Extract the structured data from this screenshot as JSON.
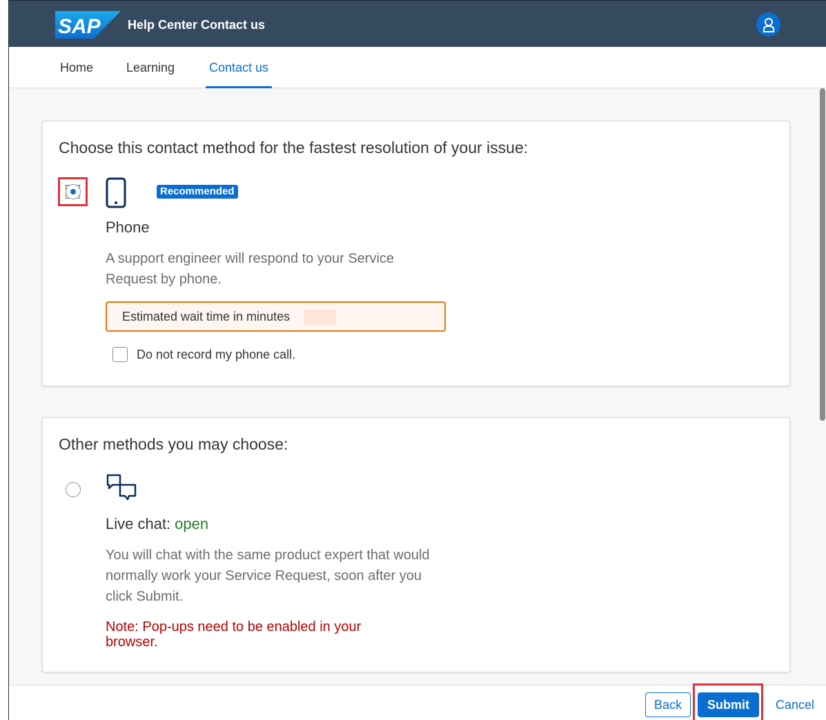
{
  "shell": {
    "logo_text": "SAP",
    "title": "Help Center Contact us"
  },
  "tabs": [
    {
      "label": "Home",
      "active": false
    },
    {
      "label": "Learning",
      "active": false
    },
    {
      "label": "Contact us",
      "active": true
    }
  ],
  "recommended_card": {
    "heading": "Choose this contact method for the fastest resolution of your issue:",
    "option": {
      "badge": "Recommended",
      "icon": "phone-icon",
      "title": "Phone",
      "description": "A support engineer will respond to your Service Request by phone.",
      "wait_label": "Estimated wait time in minutes",
      "selected": true
    },
    "checkbox_label": "Do not record my phone call."
  },
  "other_card": {
    "heading": "Other methods you may choose:",
    "option": {
      "icon": "chat-bubbles-icon",
      "title": "Live chat:",
      "status": "open",
      "description": "You will chat with the same product expert that would normally work your Service Request, soon after you click Submit.",
      "note": "Note: Pop-ups need to be enabled in your browser.",
      "selected": false
    }
  },
  "footer": {
    "back_label": "Back",
    "submit_label": "Submit",
    "cancel_label": "Cancel"
  },
  "colors": {
    "shell": "#354a5f",
    "accent": "#0a6ed1",
    "warning": "#e9730c",
    "error": "#bb0000",
    "positive": "#2b7c2b"
  }
}
